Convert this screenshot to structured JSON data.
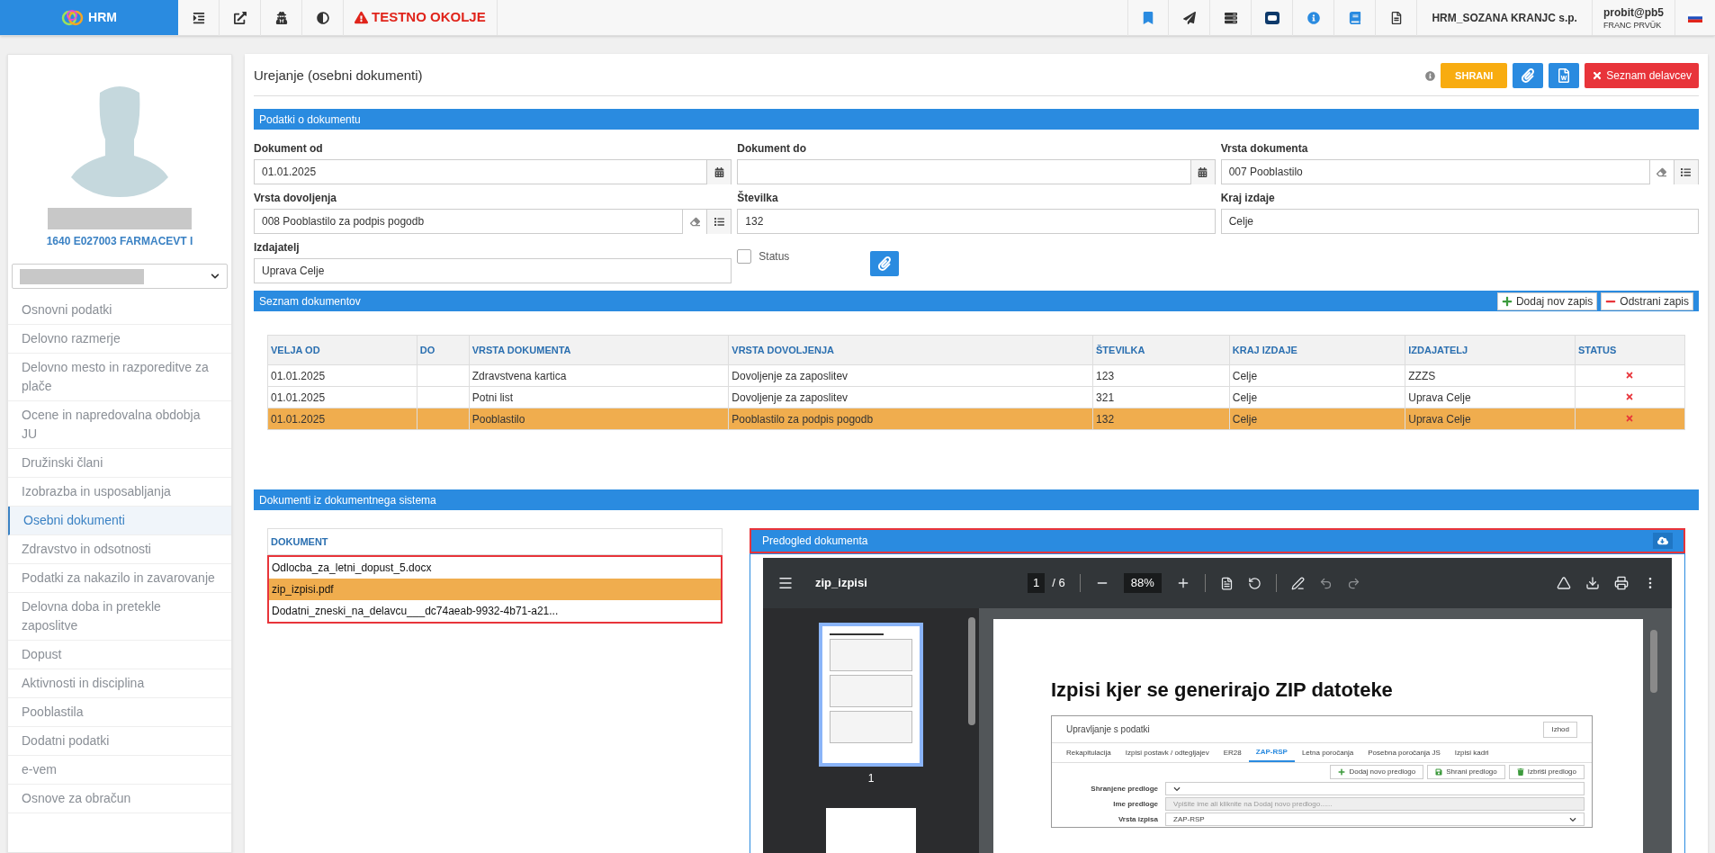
{
  "top_bar": {
    "logo": "HRM",
    "environment": "TESTNO OKOLJE",
    "company": "HRM_SOZANA KRANJC s.p.",
    "user": "probit@pb5",
    "user_name": "FRANC PRVÜK"
  },
  "sidebar": {
    "position": "1640 E027003 FARMACEVT I",
    "items": [
      {
        "label": "Osnovni podatki",
        "selected": false
      },
      {
        "label": "Delovno razmerje",
        "selected": false
      },
      {
        "label": "Delovno mesto in razporeditve za plače",
        "selected": false
      },
      {
        "label": "Ocene in napredovalna obdobja JU",
        "selected": false
      },
      {
        "label": "Družinski člani",
        "selected": false
      },
      {
        "label": "Izobrazba in usposabljanja",
        "selected": false
      },
      {
        "label": "Osebni dokumenti",
        "selected": true
      },
      {
        "label": "Zdravstvo in odsotnosti",
        "selected": false
      },
      {
        "label": "Podatki za nakazilo in zavarovanje",
        "selected": false
      },
      {
        "label": "Delovna doba in pretekle zaposlitve",
        "selected": false
      },
      {
        "label": "Dopust",
        "selected": false
      },
      {
        "label": "Aktivnosti in disciplina",
        "selected": false
      },
      {
        "label": "Pooblastila",
        "selected": false
      },
      {
        "label": "Dodatni podatki",
        "selected": false
      },
      {
        "label": "e-vem",
        "selected": false
      },
      {
        "label": "Osnove za obračun",
        "selected": false
      }
    ]
  },
  "page": {
    "title": "Urejanje (osebni dokumenti)",
    "save_button": "SHRANI",
    "list_button": "Seznam delavcev"
  },
  "form": {
    "header": "Podatki o dokumentu",
    "fields": [
      {
        "label": "Dokument od",
        "value": "01.01.2025",
        "kind": "date"
      },
      {
        "label": "Dokument do",
        "kind": "date"
      },
      {
        "label": "Vrsta dokumenta",
        "value": "007 Pooblastilo",
        "kind": "lookup"
      },
      {
        "label": "Vrsta dovoljenja",
        "value": "008 Pooblastilo za podpis pogodb",
        "kind": "lookup"
      },
      {
        "label": "Številka",
        "value": "132",
        "kind": "text"
      },
      {
        "label": "Kraj izdaje",
        "value": "Celje",
        "kind": "text"
      },
      {
        "label": "Izdajatelj",
        "value": "Uprava Celje",
        "kind": "text"
      }
    ],
    "status": {
      "label": "Status",
      "checked": false
    }
  },
  "documents": {
    "header": "Seznam dokumentov",
    "add_button": "Dodaj nov zapis",
    "remove_button": "Odstrani zapis",
    "columns": [
      "VELJA OD",
      "DO",
      "VRSTA DOKUMENTA",
      "VRSTA DOVOLJENJA",
      "ŠTEVILKA",
      "KRAJ IZDAJE",
      "IZDAJATELJ",
      "STATUS"
    ],
    "rows": [
      {
        "cells": [
          "01.01.2025",
          null,
          "Zdravstvena kartica",
          "Dovoljenje za zaposlitev",
          "123",
          "Celje",
          "ZZZS"
        ],
        "status": false,
        "selected": false
      },
      {
        "cells": [
          "01.01.2025",
          null,
          "Potni list",
          "Dovoljenje za zaposlitev",
          "321",
          "Celje",
          "Uprava Celje"
        ],
        "status": false,
        "selected": false
      },
      {
        "cells": [
          "01.01.2025",
          null,
          "Pooblastilo",
          "Pooblastilo za podpis pogodb",
          "132",
          "Celje",
          "Uprava Celje"
        ],
        "status": false,
        "selected": true
      }
    ]
  },
  "dms": {
    "header": "Dokumenti iz dokumentnega sistema",
    "list_header": "DOKUMENT",
    "files": [
      {
        "name": "Odlocba_za_letni_dopust_5.docx",
        "selected": false
      },
      {
        "name": "zip_izpisi.pdf",
        "selected": true
      },
      {
        "name": "Dodatni_zneski_na_delavcu___dc74aeab-9932-4b71-a21...",
        "selected": false
      }
    ],
    "preview_header": "Predogled dokumenta",
    "viewer": {
      "file": "zip_izpisi",
      "page": "1",
      "pages": "/ 6",
      "zoom": "88%",
      "thumb_label": "1",
      "doc_title": "Izpisi kjer se generirajo ZIP datoteke",
      "app_title": "Upravljanje s podatki",
      "exit_button": "Izhod",
      "tabs": [
        {
          "label": "Rekapitulacija",
          "selected": false
        },
        {
          "label": "Izpisi postavk / odtegljajev",
          "selected": false
        },
        {
          "label": "ER28",
          "selected": false
        },
        {
          "label": "ZAP-RSP",
          "selected": true
        },
        {
          "label": "Letna poročanja",
          "selected": false
        },
        {
          "label": "Posebna poročanja JS",
          "selected": false
        },
        {
          "label": "Izpisi kadri",
          "selected": false
        }
      ],
      "buttons": [
        "Dodaj novo predlogo",
        "Shrani predlogo",
        "Izbriši predlogo"
      ],
      "fields": [
        {
          "label": "Shranjene predloge",
          "kind": "select"
        },
        {
          "label": "Ime predloge",
          "placeholder": "Vpišite ime ali kliknite na Dodaj novo predlogo......",
          "kind": "input"
        },
        {
          "label": "Vrsta izpisa",
          "value": "ZAP-RSP",
          "kind": "select"
        }
      ]
    }
  }
}
